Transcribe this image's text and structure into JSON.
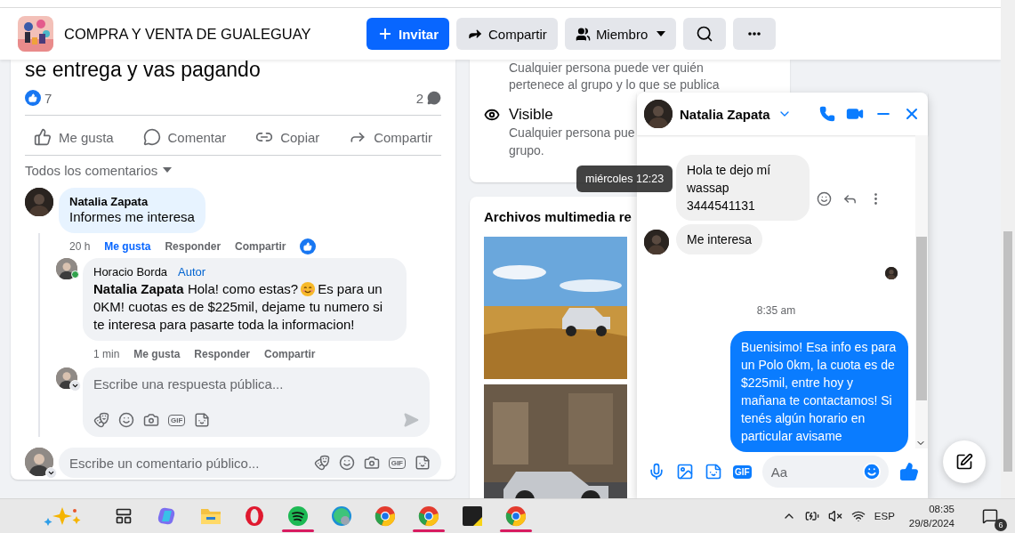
{
  "header": {
    "group_name": "COMPRA Y VENTA DE GUALEGUAY",
    "buttons": [
      {
        "kind": "invite",
        "label": "Invitar"
      },
      {
        "kind": "share",
        "label": "Compartir"
      },
      {
        "kind": "members",
        "label": "Miembro"
      },
      {
        "kind": "search"
      },
      {
        "kind": "more"
      }
    ]
  },
  "post": {
    "text": "se entrega y vas pagando",
    "likes": "7",
    "comment_count": "2",
    "actions": [
      {
        "kind": "like",
        "label": "Me gusta"
      },
      {
        "kind": "comment",
        "label": "Comentar"
      },
      {
        "kind": "copy",
        "label": "Copiar"
      },
      {
        "kind": "share",
        "label": "Compartir"
      }
    ],
    "filter": "Todos los comentarios",
    "comments": [
      {
        "author": "Natalia Zapata",
        "text": "Informes me interesa",
        "time": "20 h",
        "liked": true,
        "like": "Me gusta",
        "reply": "Responder",
        "share": "Compartir",
        "reacted": true,
        "replies": [
          {
            "author": "Horacio Borda",
            "badge": "Autor",
            "online": true,
            "text_before": "**Natalia Zapata** Hola! como estas?",
            "text_after": "Es para un",
            "text_continued": "0KM! cuotas es de $225mil, dejame tu numero si te interesa para pasarte toda la informacion!",
            "time": "1 min",
            "liked": false,
            "like": "Me gusta",
            "reply": "Responder",
            "share": "Compartir"
          }
        ],
        "reply_placeholder": "Escribe una respuesta pública...",
        "gif": "GIF"
      }
    ],
    "comment_placeholder": "Escribe un comentario público...",
    "gif": "GIF"
  },
  "about": {
    "privacy_desc": "Cualquier persona puede ver quién pertenece al grupo y lo que se publica",
    "visible_title": "Visible",
    "visible_desc_lines": [
      "Cualquier persona pue",
      "grupo."
    ]
  },
  "media": {
    "title": "Archivos multimedia re"
  },
  "chat": {
    "contact": "Natalia Zapata",
    "messages": [
      {
        "kind": "received",
        "text": "Hola te dejo mí wassap 3444541131",
        "avatar": false,
        "hovered": true
      },
      {
        "kind": "received",
        "text": "Me interesa",
        "avatar": true,
        "hovered": false
      },
      {
        "kind": "seen"
      },
      {
        "kind": "time",
        "text": "8:35 am"
      },
      {
        "kind": "sent",
        "text": "Buenisimo! Esa info es para un Polo 0km, la cuota es de $225mil, entre hoy y mañana te contactamos! Si tenés algún horario en particular avisame"
      }
    ],
    "gif": "GIF",
    "composer_placeholder": "Aa"
  },
  "tooltip": "miércoles 12:23",
  "taskbar": {
    "apps": [
      {
        "kind": "widgets",
        "running": false
      },
      {
        "kind": "taskview",
        "running": false
      },
      {
        "kind": "copilot",
        "running": false
      },
      {
        "kind": "files",
        "running": false
      },
      {
        "kind": "opera",
        "running": false
      },
      {
        "kind": "spotify",
        "running": true
      },
      {
        "kind": "edge",
        "running": false
      },
      {
        "kind": "chrome",
        "running": false
      },
      {
        "kind": "chrome",
        "running": true
      },
      {
        "kind": "sticky",
        "running": false
      },
      {
        "kind": "chrome",
        "running": true
      }
    ],
    "language": "ESP",
    "time": "08:35",
    "date": "29/8/2024",
    "notifications": "6"
  }
}
